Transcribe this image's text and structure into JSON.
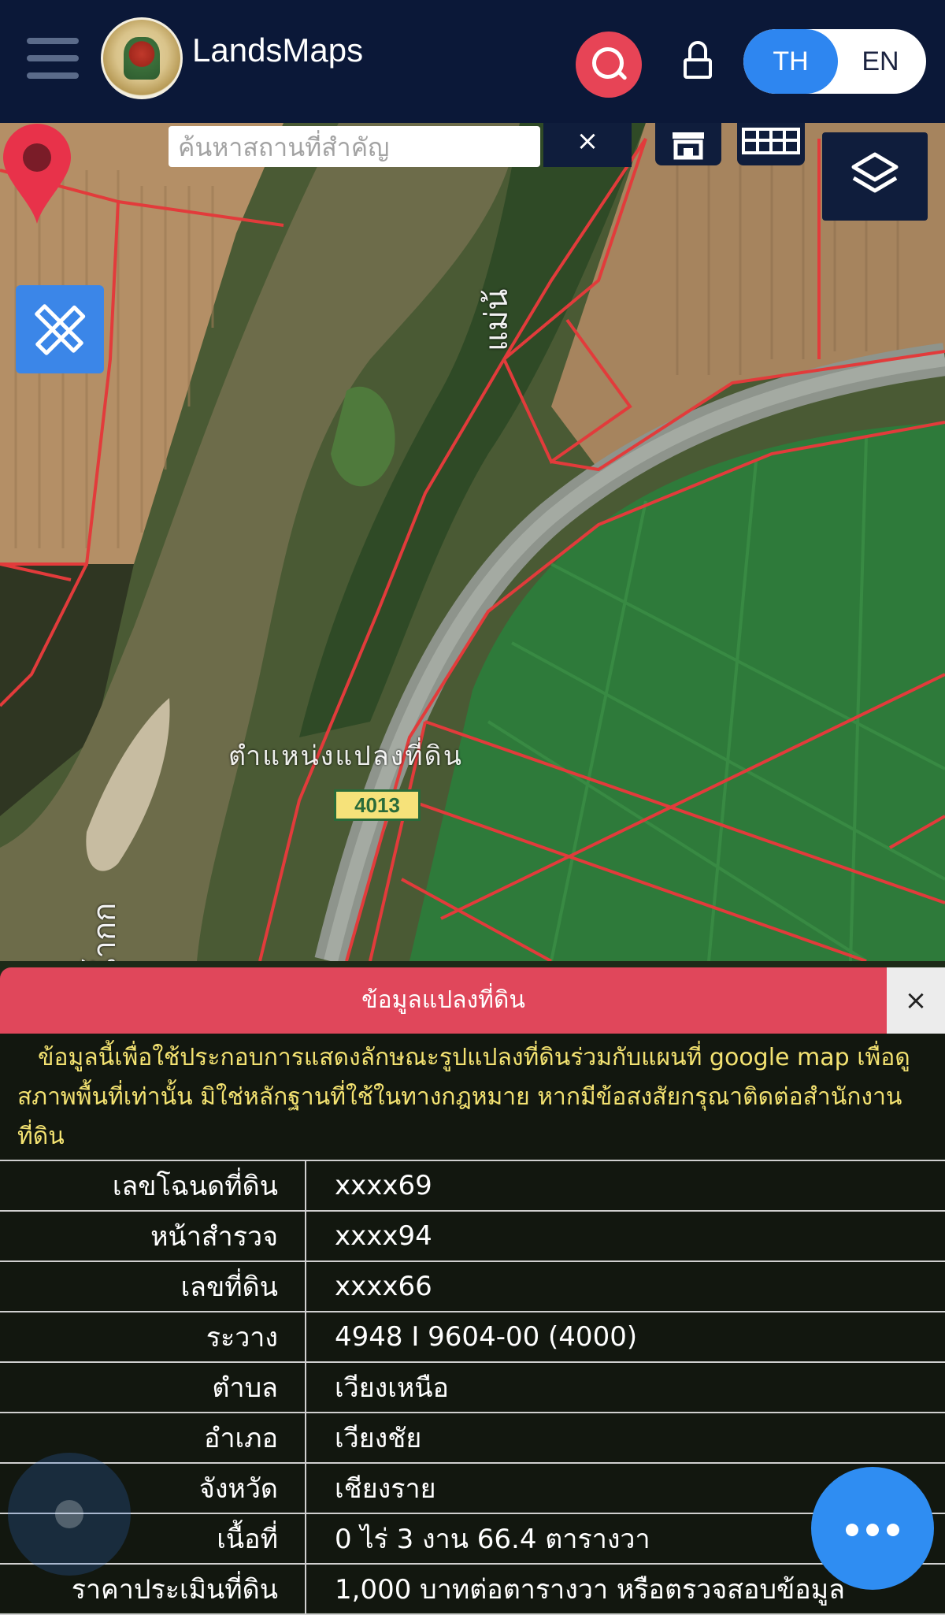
{
  "header": {
    "app_name": "LandsMaps",
    "lang_options": [
      "TH",
      "EN"
    ],
    "lang_selected": "TH"
  },
  "map": {
    "search_placeholder": "ค้นหาสถานที่สำคัญ",
    "search_clear": "×",
    "river_label": "แม่น้ำกก",
    "river_label_top": "แม่น้",
    "place_label": "ตำแหน่งแปลงที่ดิน",
    "road_number": "4013"
  },
  "panel": {
    "title": "ข้อมูลแปลงที่ดิน",
    "close": "×",
    "notice": "ข้อมูลนี้เพื่อใช้ประกอบการแสดงลักษณะรูปแปลงที่ดินร่วมกับแผนที่ google map เพื่อดูสภาพพื้นที่เท่านั้น มิใช่หลักฐานที่ใช้ในทางกฎหมาย หากมีข้อสงสัยกรุณาติดต่อสำนักงานที่ดิน",
    "rows": [
      {
        "label": "เลขโฉนดที่ดิน",
        "value": "xxxx69"
      },
      {
        "label": "หน้าสำรวจ",
        "value": "xxxx94"
      },
      {
        "label": "เลขที่ดิน",
        "value": "xxxx66"
      },
      {
        "label": "ระวาง",
        "value": "4948 I 9604-00 (4000)"
      },
      {
        "label": "ตำบล",
        "value": "เวียงเหนือ"
      },
      {
        "label": "อำเภอ",
        "value": "เวียงชัย"
      },
      {
        "label": "จังหวัด",
        "value": "เชียงราย"
      },
      {
        "label": "เนื้อที่",
        "value": "0 ไร่ 3 งาน 66.4 ตารางวา"
      },
      {
        "label": "ราคาประเมินที่ดิน",
        "value": "1,000 บาทต่อตารางวา หรือตรวจสอบข้อมูล"
      }
    ]
  },
  "colors": {
    "header_bg": "#0b1838",
    "accent_red": "#e74456",
    "accent_blue": "#2e86f0",
    "notice_text": "#f3e271",
    "parcel_line": "#e23b3b"
  },
  "icons": [
    "menu-icon",
    "search-icon",
    "lock-icon",
    "home-icon",
    "grid-icon",
    "layers-icon",
    "ruler-pencil-icon",
    "location-pin-icon",
    "more-icon",
    "info-icon"
  ]
}
